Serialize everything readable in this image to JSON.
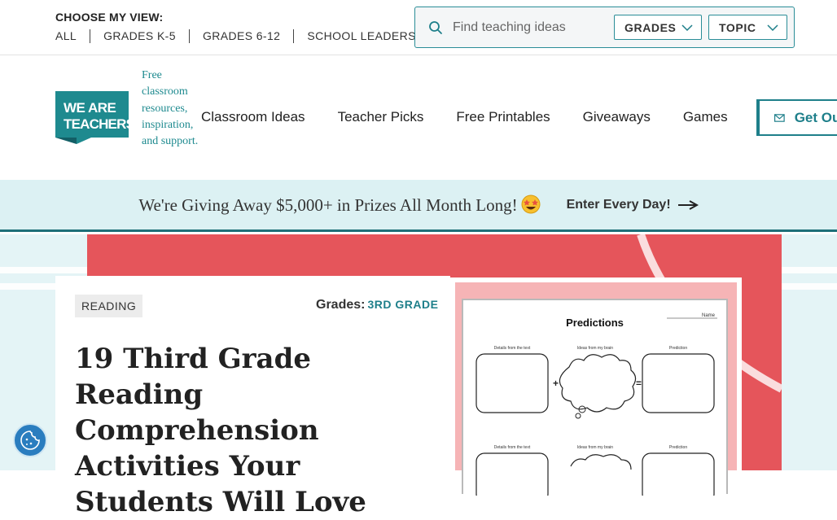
{
  "utility_bar": {
    "view_label": "CHOOSE MY VIEW:",
    "view_links": [
      "ALL",
      "GRADES K-5",
      "GRADES 6-12",
      "SCHOOL LEADERS"
    ],
    "search": {
      "placeholder": "Find teaching ideas"
    },
    "filters": {
      "grades_label": "GRADES",
      "topic_label": "TOPIC"
    }
  },
  "header": {
    "logo_text": "WE ARE TEACHERS",
    "tagline": "Free classroom resources, inspiration, and support.",
    "nav": [
      "Classroom Ideas",
      "Teacher Picks",
      "Free Printables",
      "Giveaways",
      "Games"
    ],
    "cta_label": "Get Our"
  },
  "promo": {
    "text": "We're Giving Away $5,000+ in Prizes All Month Long!",
    "link_label": "Enter Every Day!"
  },
  "article": {
    "category": "READING",
    "grades_label": "Grades:",
    "grades_value": "3RD GRADE",
    "title": "19 Third Grade Reading Comprehension Activities Your Students Will Love"
  },
  "worksheet": {
    "title": "Predictions",
    "name_label": "Name",
    "column_labels": [
      "Details from the text",
      "Ideas from my brain",
      "Prediction"
    ]
  },
  "colors": {
    "brand_teal": "#1e8a8f",
    "banner_bg": "#dcf1f3",
    "hero_coral": "#e5555b"
  }
}
